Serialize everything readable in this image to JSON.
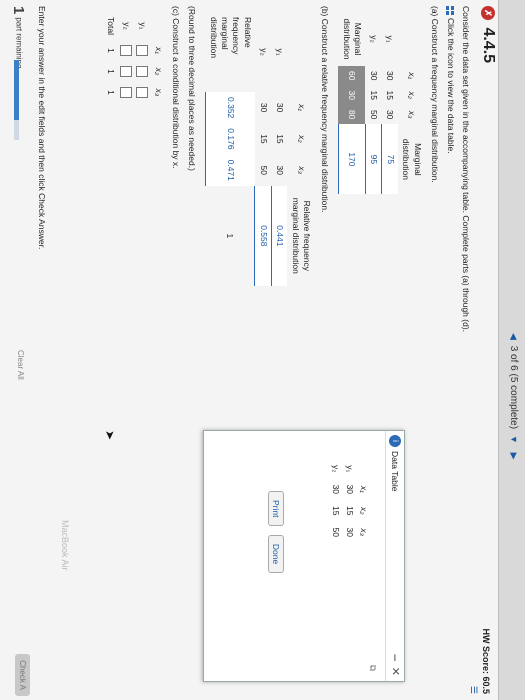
{
  "nav": {
    "progress_text": "3 of 6 (5 complete)"
  },
  "score": {
    "label": "HW Score: 60.5"
  },
  "question": {
    "number": "4.4.5",
    "intro": "Consider the data set given in the accompanying table. Complete parts (a) through (d).",
    "icon_hint": "Click the icon to view the data table."
  },
  "part_a": {
    "title": "(a) Construct a frequency marginal distribution.",
    "headers": [
      "x₁",
      "x₂",
      "x₃",
      "Marginal distribution"
    ],
    "rows": [
      {
        "label": "y₁",
        "values": [
          "30",
          "15",
          "30",
          "75"
        ]
      },
      {
        "label": "y₂",
        "values": [
          "30",
          "15",
          "50",
          "95"
        ]
      },
      {
        "label": "Marginal distribution",
        "values": [
          "60",
          "30",
          "80",
          "170"
        ]
      }
    ]
  },
  "part_b": {
    "title": "(b) Construct a relative frequency marginal distribution.",
    "headers": [
      "x₁",
      "x₂",
      "x₃",
      "Relative frequency marginal distribution"
    ],
    "rows": [
      {
        "label": "y₁",
        "values": [
          "30",
          "15",
          "30",
          "0.441"
        ]
      },
      {
        "label": "y₂",
        "values": [
          "30",
          "15",
          "50",
          "0.558"
        ]
      },
      {
        "label": "Relative frequency marginal distribution",
        "values": [
          "0.352",
          "0.176",
          "0.471",
          "1"
        ]
      }
    ],
    "note": "(Round to three decimal places as needed.)"
  },
  "part_c": {
    "title": "(c) Construct a conditional distribution by x.",
    "headers": [
      "x₁",
      "x₂",
      "x₃"
    ],
    "rows": [
      {
        "label": "y₁"
      },
      {
        "label": "y₂"
      },
      {
        "label": "Total",
        "values": [
          "1",
          "1",
          "1"
        ]
      }
    ]
  },
  "footer": {
    "instruction": "Enter your answer in the edit fields and then click Check Answer.",
    "part_count": "1",
    "part_label": "part remaining",
    "progress": 0.75,
    "clear_all": "Clear All",
    "check": "Check A"
  },
  "popup": {
    "title": "Data Table",
    "headers": [
      "x₁",
      "x₂",
      "x₃"
    ],
    "rows": [
      {
        "label": "y₁",
        "values": [
          "30",
          "15",
          "30"
        ]
      },
      {
        "label": "y₂",
        "values": [
          "30",
          "15",
          "50"
        ]
      }
    ],
    "print": "Print",
    "done": "Done"
  },
  "background": {
    "watermark": "MacBook Air"
  },
  "colors": {
    "accent": "#2c6bb5",
    "badge": "#c43131"
  }
}
